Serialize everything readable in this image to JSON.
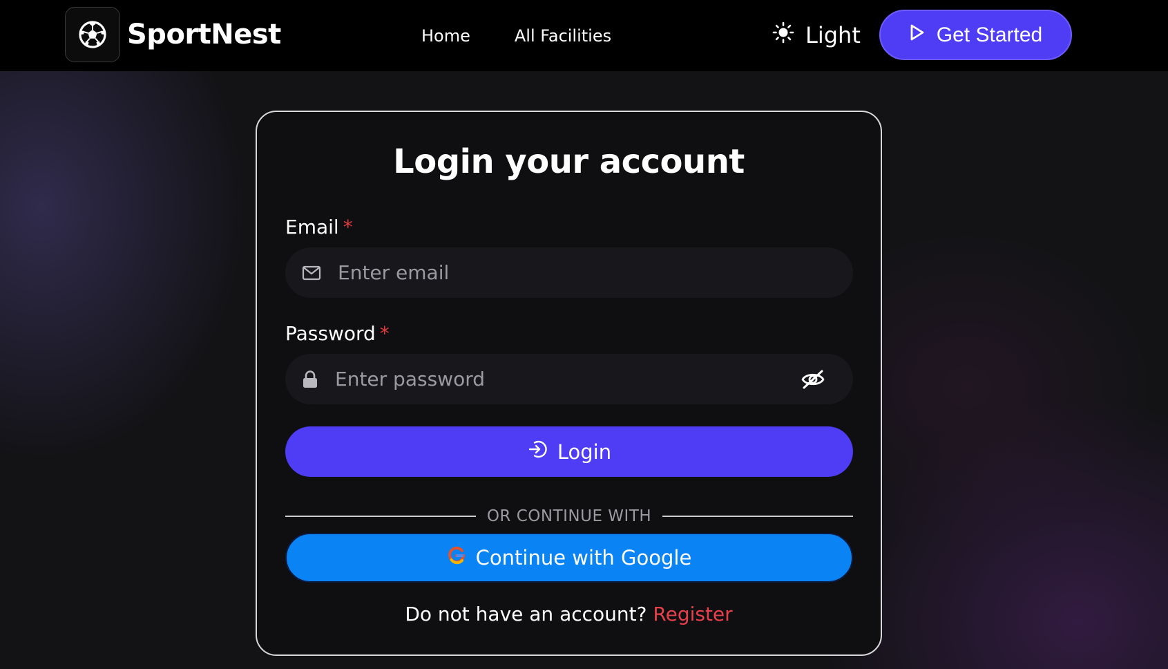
{
  "navbar": {
    "brand_name": "SportNest",
    "links": [
      {
        "label": "Home"
      },
      {
        "label": "All Facilities"
      }
    ],
    "theme_label": "Light",
    "cta_label": "Get Started"
  },
  "login": {
    "title": "Login your account",
    "email_label": "Email",
    "email_placeholder": "Enter email",
    "password_label": "Password",
    "password_placeholder": "Enter password",
    "required_mark": "*",
    "login_button": "Login",
    "divider_text": "OR CONTINUE WITH",
    "google_button": "Continue with Google",
    "register_prompt": "Do not have an account?",
    "register_link": "Register"
  },
  "colors": {
    "accent": "#4f3cf5",
    "google_button": "#0a83f4",
    "required": "#e03a3a",
    "register_link": "#e8404a"
  },
  "icons": {
    "brand": "soccer-ball-icon",
    "theme": "sun-icon",
    "cta": "play-icon",
    "email": "mail-icon",
    "password": "lock-icon",
    "password_toggle": "eye-off-icon",
    "login": "login-arrow-icon",
    "google": "google-icon"
  }
}
